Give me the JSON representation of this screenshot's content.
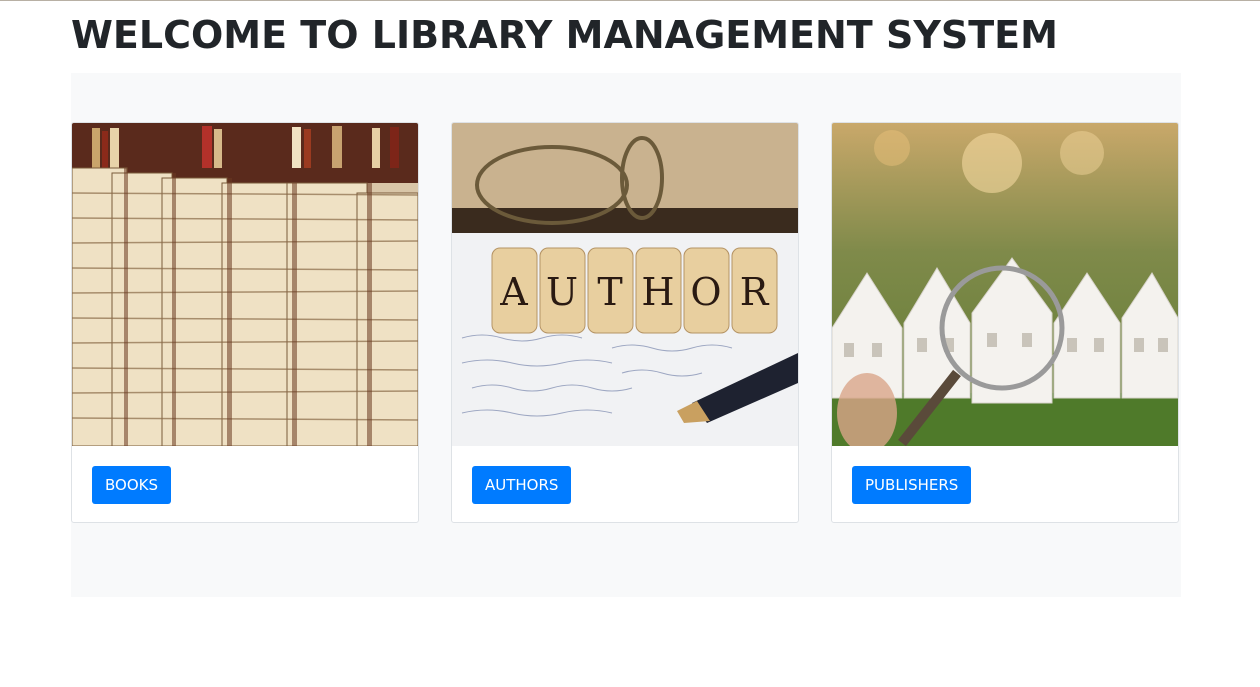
{
  "page": {
    "title": "WELCOME TO LIBRARY MANAGEMENT SYSTEM"
  },
  "cards": [
    {
      "image_subject": "stacks-of-books",
      "button_label": "BOOKS"
    },
    {
      "image_subject": "author-letter-blocks",
      "button_label": "AUTHORS"
    },
    {
      "image_subject": "paper-houses-magnifier",
      "button_label": "PUBLISHERS"
    }
  ],
  "colors": {
    "primary_button": "#007bff",
    "panel_background": "#f8f9fa",
    "title_text": "#212529"
  }
}
